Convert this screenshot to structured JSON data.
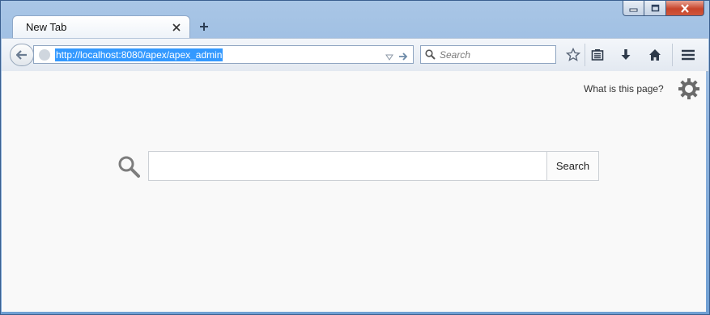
{
  "window": {
    "caption_buttons": [
      "minimize",
      "maximize",
      "close"
    ]
  },
  "tabs": [
    {
      "title": "New Tab",
      "close_icon": "close-icon"
    }
  ],
  "newtab_icon": "plus-icon",
  "navbar": {
    "url": "http://localhost:8080/apex/apex_admin",
    "search_placeholder": "Search",
    "icons": [
      "back-arrow-icon",
      "globe-icon",
      "dropdown-triangle-icon",
      "go-arrow-icon",
      "search-icon",
      "star-icon",
      "reading-list-icon",
      "download-icon",
      "home-icon",
      "menu-icon"
    ]
  },
  "content": {
    "whatis_link": "What is this page?",
    "search_button": "Search",
    "colors": {
      "selection": "#3399ff",
      "page_bg": "#f9f9f9"
    }
  }
}
